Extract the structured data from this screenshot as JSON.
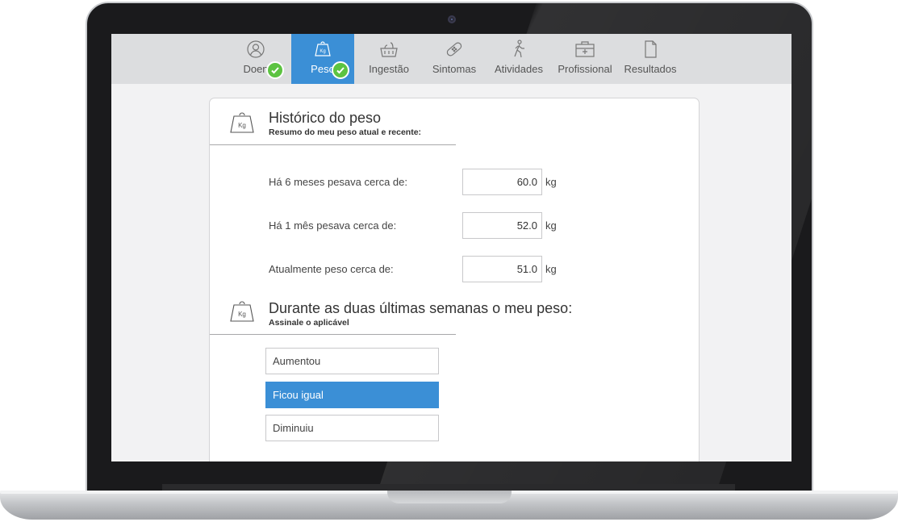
{
  "nav": {
    "tabs": [
      {
        "label": "Doen",
        "icon": "user-icon",
        "completed": true,
        "active": false
      },
      {
        "label": "Peso",
        "icon": "weight-icon",
        "completed": true,
        "active": true
      },
      {
        "label": "Ingestão",
        "icon": "basket-icon",
        "completed": false,
        "active": false
      },
      {
        "label": "Sintomas",
        "icon": "bandage-icon",
        "completed": false,
        "active": false
      },
      {
        "label": "Atividades",
        "icon": "walking-icon",
        "completed": false,
        "active": false
      },
      {
        "label": "Profissional",
        "icon": "medical-kit-icon",
        "completed": false,
        "active": false
      },
      {
        "label": "Resultados",
        "icon": "document-icon",
        "completed": false,
        "active": false
      }
    ]
  },
  "history": {
    "icon_label": "Kg",
    "title": "Histórico do peso",
    "subtitle": "Resumo do meu peso atual e recente:",
    "rows": [
      {
        "label": "Há 6 meses pesava cerca de:",
        "value": "60.0",
        "unit": "kg"
      },
      {
        "label": "Há 1 mês pesava cerca de:",
        "value": "52.0",
        "unit": "kg"
      },
      {
        "label": "Atualmente peso cerca de:",
        "value": "51.0",
        "unit": "kg"
      }
    ]
  },
  "trend": {
    "icon_label": "Kg",
    "title": "Durante as duas últimas semanas o meu peso:",
    "subtitle": "Assinale o aplicável",
    "options": [
      {
        "label": "Aumentou",
        "selected": false
      },
      {
        "label": "Ficou igual",
        "selected": true
      },
      {
        "label": "Diminuiu",
        "selected": false
      }
    ]
  },
  "colors": {
    "accent": "#3b8fd6",
    "check": "#5cc341",
    "nav_bg": "#dcdddf"
  }
}
